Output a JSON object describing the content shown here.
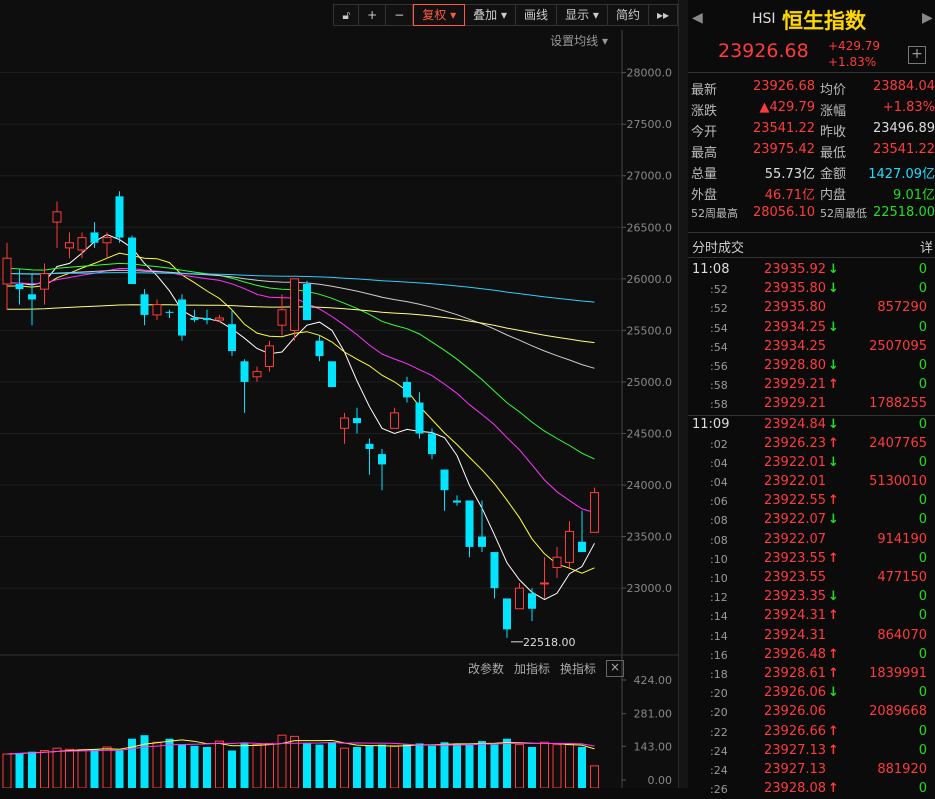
{
  "toolbar": {
    "lock_label": "",
    "zoom_in_label": "+",
    "zoom_out_label": "−",
    "adjust_label": "复权",
    "overlay_label": "叠加",
    "draw_label": "画线",
    "display_label": "显示",
    "simple_label": "简约",
    "more_label": "▸▸",
    "ma_settings_label": "设置均线"
  },
  "sub_toolbar": {
    "params": "改参数",
    "add_indicator": "加指标",
    "switch_indicator": "换指标",
    "close": "×"
  },
  "colors": {
    "up": "#ff3b3b",
    "down": "#00e5ff",
    "ma5": "#ffffff",
    "ma10": "#ffff33",
    "ma20": "#ff33ff",
    "ma30": "#33ff33",
    "ma60": "#cccccc",
    "ma120": "#ffff88",
    "ma250": "#33ccff"
  },
  "chart_data": [
    {
      "type": "candlestick",
      "ylim": [
        22400,
        28200
      ],
      "y_ticks": [
        "28000.0",
        "27500.0",
        "27000.0",
        "26500.0",
        "26000.0",
        "25500.0",
        "25000.0",
        "24500.0",
        "24000.0",
        "23500.0",
        "23000.0"
      ],
      "low_annotation": "22518.00",
      "candles": [
        {
          "o": 25950,
          "h": 26350,
          "l": 25700,
          "c": 26200
        },
        {
          "o": 25950,
          "h": 26100,
          "l": 25750,
          "c": 25900
        },
        {
          "o": 25850,
          "h": 26050,
          "l": 25550,
          "c": 25800
        },
        {
          "o": 25900,
          "h": 26150,
          "l": 25750,
          "c": 26050
        },
        {
          "o": 26550,
          "h": 26750,
          "l": 26300,
          "c": 26650
        },
        {
          "o": 26300,
          "h": 26450,
          "l": 26200,
          "c": 26350
        },
        {
          "o": 26280,
          "h": 26450,
          "l": 26200,
          "c": 26400
        },
        {
          "o": 26450,
          "h": 26550,
          "l": 26300,
          "c": 26350
        },
        {
          "o": 26350,
          "h": 26450,
          "l": 26200,
          "c": 26400
        },
        {
          "o": 26800,
          "h": 26850,
          "l": 26350,
          "c": 26400
        },
        {
          "o": 26400,
          "h": 26420,
          "l": 25950,
          "c": 25950
        },
        {
          "o": 25850,
          "h": 25900,
          "l": 25550,
          "c": 25650
        },
        {
          "o": 25650,
          "h": 25800,
          "l": 25600,
          "c": 25750
        },
        {
          "o": 25680,
          "h": 25700,
          "l": 25620,
          "c": 25670
        },
        {
          "o": 25800,
          "h": 25850,
          "l": 25400,
          "c": 25450
        },
        {
          "o": 25620,
          "h": 25700,
          "l": 25580,
          "c": 25600
        },
        {
          "o": 25620,
          "h": 25700,
          "l": 25560,
          "c": 25600
        },
        {
          "o": 25600,
          "h": 25650,
          "l": 25580,
          "c": 25620
        },
        {
          "o": 25560,
          "h": 25700,
          "l": 25250,
          "c": 25300
        },
        {
          "o": 25200,
          "h": 25220,
          "l": 24700,
          "c": 25000
        },
        {
          "o": 25050,
          "h": 25150,
          "l": 25000,
          "c": 25100
        },
        {
          "o": 25150,
          "h": 25400,
          "l": 25100,
          "c": 25350
        },
        {
          "o": 25550,
          "h": 25850,
          "l": 25450,
          "c": 25700
        },
        {
          "o": 25500,
          "h": 26000,
          "l": 25400,
          "c": 26000
        },
        {
          "o": 25950,
          "h": 25980,
          "l": 25600,
          "c": 25600
        },
        {
          "o": 25400,
          "h": 25450,
          "l": 25200,
          "c": 25250
        },
        {
          "o": 25200,
          "h": 25200,
          "l": 24950,
          "c": 24950
        },
        {
          "o": 24550,
          "h": 24700,
          "l": 24400,
          "c": 24650
        },
        {
          "o": 24650,
          "h": 24750,
          "l": 24500,
          "c": 24600
        },
        {
          "o": 24400,
          "h": 24450,
          "l": 24100,
          "c": 24350
        },
        {
          "o": 24300,
          "h": 24350,
          "l": 23950,
          "c": 24200
        },
        {
          "o": 24550,
          "h": 24750,
          "l": 24550,
          "c": 24700
        },
        {
          "o": 25000,
          "h": 25050,
          "l": 24800,
          "c": 24850
        },
        {
          "o": 24800,
          "h": 24900,
          "l": 24450,
          "c": 24500
        },
        {
          "o": 24500,
          "h": 24550,
          "l": 24250,
          "c": 24300
        },
        {
          "o": 24150,
          "h": 24150,
          "l": 23750,
          "c": 23950
        },
        {
          "o": 23850,
          "h": 23900,
          "l": 23800,
          "c": 23830
        },
        {
          "o": 23850,
          "h": 23850,
          "l": 23300,
          "c": 23400
        },
        {
          "o": 23500,
          "h": 23850,
          "l": 23350,
          "c": 23400
        },
        {
          "o": 23350,
          "h": 23350,
          "l": 22900,
          "c": 23000
        },
        {
          "o": 22900,
          "h": 22900,
          "l": 22518,
          "c": 22600
        },
        {
          "o": 22800,
          "h": 23050,
          "l": 22800,
          "c": 23000
        },
        {
          "o": 22950,
          "h": 23000,
          "l": 22680,
          "c": 22800
        },
        {
          "o": 23050,
          "h": 23300,
          "l": 22900,
          "c": 23050
        },
        {
          "o": 23200,
          "h": 23400,
          "l": 23100,
          "c": 23300
        },
        {
          "o": 23250,
          "h": 23650,
          "l": 23200,
          "c": 23550
        },
        {
          "o": 23450,
          "h": 23750,
          "l": 23350,
          "c": 23350
        },
        {
          "o": 23541.22,
          "h": 23975.42,
          "l": 23541.22,
          "c": 23926.68
        }
      ]
    },
    {
      "type": "bar",
      "y_ticks": [
        "424.00",
        "281.00",
        "143.00",
        "0.00"
      ],
      "ylim": [
        0,
        424
      ],
      "values": [
        110,
        115,
        120,
        125,
        135,
        130,
        128,
        130,
        140,
        125,
        175,
        190,
        160,
        175,
        150,
        145,
        140,
        165,
        125,
        155,
        150,
        155,
        190,
        185,
        155,
        150,
        160,
        135,
        140,
        145,
        150,
        145,
        150,
        155,
        145,
        160,
        155,
        150,
        165,
        150,
        175,
        150,
        140,
        160,
        150,
        150,
        140,
        60
      ]
    }
  ],
  "quote": {
    "arrow_left": "◀",
    "arrow_right": "▶",
    "code": "HSI",
    "name": "恒生指数",
    "price": "23926.68",
    "change": "+429.79",
    "change_pct": "+1.83%",
    "plus": "+",
    "rows": [
      {
        "l1": "最新",
        "v1": "23926.68",
        "c1": "red",
        "l2": "均价",
        "v2": "23884.04",
        "c2": "red"
      },
      {
        "l1": "涨跌",
        "v1": "▲429.79",
        "c1": "red",
        "l2": "涨幅",
        "v2": "+1.83%",
        "c2": "red"
      },
      {
        "l1": "今开",
        "v1": "23541.22",
        "c1": "red",
        "l2": "昨收",
        "v2": "23496.89",
        "c2": "white"
      },
      {
        "l1": "最高",
        "v1": "23975.42",
        "c1": "red",
        "l2": "最低",
        "v2": "23541.22",
        "c2": "red"
      },
      {
        "l1": "总量",
        "v1": "55.73亿",
        "c1": "white",
        "l2": "金额",
        "v2": "1427.09亿",
        "c2": "cyan"
      },
      {
        "l1": "外盘",
        "v1": "46.71亿",
        "c1": "red",
        "l2": "内盘",
        "v2": "9.01亿",
        "c2": "green"
      },
      {
        "l1": "52周最高",
        "v1": "28056.10",
        "c1": "red",
        "l2": "52周最低",
        "v2": "22518.00",
        "c2": "green",
        "small": true
      }
    ]
  },
  "trades": {
    "title": "分时成交",
    "detail": "详",
    "rows": [
      {
        "time": "11:08",
        "price": "23935.92",
        "dir": "down",
        "vol": "0",
        "main": true
      },
      {
        "time": ":52",
        "price": "23935.80",
        "dir": "down",
        "vol": "0"
      },
      {
        "time": ":52",
        "price": "23935.80",
        "dir": "",
        "vol": "857290"
      },
      {
        "time": ":54",
        "price": "23934.25",
        "dir": "down",
        "vol": "0"
      },
      {
        "time": ":54",
        "price": "23934.25",
        "dir": "",
        "vol": "2507095"
      },
      {
        "time": ":56",
        "price": "23928.80",
        "dir": "down",
        "vol": "0"
      },
      {
        "time": ":58",
        "price": "23929.21",
        "dir": "up",
        "vol": "0"
      },
      {
        "time": ":58",
        "price": "23929.21",
        "dir": "",
        "vol": "1788255"
      },
      {
        "time": "11:09",
        "price": "23924.84",
        "dir": "down",
        "vol": "0",
        "main": true
      },
      {
        "time": ":02",
        "price": "23926.23",
        "dir": "up",
        "vol": "2407765"
      },
      {
        "time": ":04",
        "price": "23922.01",
        "dir": "down",
        "vol": "0"
      },
      {
        "time": ":04",
        "price": "23922.01",
        "dir": "",
        "vol": "5130010"
      },
      {
        "time": ":06",
        "price": "23922.55",
        "dir": "up",
        "vol": "0"
      },
      {
        "time": ":08",
        "price": "23922.07",
        "dir": "down",
        "vol": "0"
      },
      {
        "time": ":08",
        "price": "23922.07",
        "dir": "",
        "vol": "914190"
      },
      {
        "time": ":10",
        "price": "23923.55",
        "dir": "up",
        "vol": "0"
      },
      {
        "time": ":10",
        "price": "23923.55",
        "dir": "",
        "vol": "477150"
      },
      {
        "time": ":12",
        "price": "23923.35",
        "dir": "down",
        "vol": "0"
      },
      {
        "time": ":14",
        "price": "23924.31",
        "dir": "up",
        "vol": "0"
      },
      {
        "time": ":14",
        "price": "23924.31",
        "dir": "",
        "vol": "864070"
      },
      {
        "time": ":16",
        "price": "23926.48",
        "dir": "up",
        "vol": "0"
      },
      {
        "time": ":18",
        "price": "23928.61",
        "dir": "up",
        "vol": "1839991"
      },
      {
        "time": ":20",
        "price": "23926.06",
        "dir": "down",
        "vol": "0"
      },
      {
        "time": ":20",
        "price": "23926.06",
        "dir": "",
        "vol": "2089668"
      },
      {
        "time": ":22",
        "price": "23926.66",
        "dir": "up",
        "vol": "0"
      },
      {
        "time": ":24",
        "price": "23927.13",
        "dir": "up",
        "vol": "0"
      },
      {
        "time": ":24",
        "price": "23927.13",
        "dir": "",
        "vol": "881920"
      },
      {
        "time": ":26",
        "price": "23928.08",
        "dir": "up",
        "vol": "0"
      }
    ]
  }
}
